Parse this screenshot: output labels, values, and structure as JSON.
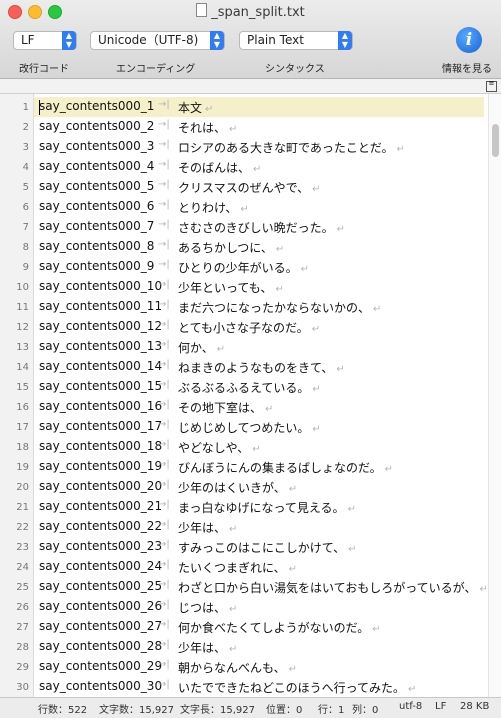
{
  "window": {
    "title": "_span_split.txt"
  },
  "toolbar": {
    "line_ending": {
      "value": "LF",
      "label": "改行コード"
    },
    "encoding": {
      "value": "Unicode（UTF-8)",
      "label": "エンコーディング"
    },
    "syntax": {
      "value": "Plain Text",
      "label": "シンタックス"
    },
    "info": {
      "label": "情報を見る"
    }
  },
  "editor": {
    "current_line": 1,
    "lines": [
      {
        "n": "1",
        "key": "say_contents000_1",
        "val": "本文"
      },
      {
        "n": "2",
        "key": "say_contents000_2",
        "val": "それは、"
      },
      {
        "n": "3",
        "key": "say_contents000_3",
        "val": "ロシアのある大きな町であったことだ。"
      },
      {
        "n": "4",
        "key": "say_contents000_4",
        "val": "そのばんは、"
      },
      {
        "n": "5",
        "key": "say_contents000_5",
        "val": "クリスマスのぜんやで、"
      },
      {
        "n": "6",
        "key": "say_contents000_6",
        "val": "とりわけ、"
      },
      {
        "n": "7",
        "key": "say_contents000_7",
        "val": "さむさのきびしい晩だった。"
      },
      {
        "n": "8",
        "key": "say_contents000_8",
        "val": "あるちかしつに、"
      },
      {
        "n": "9",
        "key": "say_contents000_9",
        "val": "ひとりの少年がいる。"
      },
      {
        "n": "10",
        "key": "say_contents000_10",
        "val": "少年といっても、"
      },
      {
        "n": "11",
        "key": "say_contents000_11",
        "val": "まだ六つになったかならないかの、"
      },
      {
        "n": "12",
        "key": "say_contents000_12",
        "val": "とても小さな子なのだ。"
      },
      {
        "n": "13",
        "key": "say_contents000_13",
        "val": "何か、"
      },
      {
        "n": "14",
        "key": "say_contents000_14",
        "val": "ねまきのようなものをきて、"
      },
      {
        "n": "15",
        "key": "say_contents000_15",
        "val": "ぶるぶるふるえている。"
      },
      {
        "n": "16",
        "key": "say_contents000_16",
        "val": "その地下室は、"
      },
      {
        "n": "17",
        "key": "say_contents000_17",
        "val": "じめじめしてつめたい。"
      },
      {
        "n": "18",
        "key": "say_contents000_18",
        "val": "やどなしや、"
      },
      {
        "n": "19",
        "key": "say_contents000_19",
        "val": "びんぼうにんの集まるばしょなのだ。"
      },
      {
        "n": "20",
        "key": "say_contents000_20",
        "val": "少年のはくいきが、"
      },
      {
        "n": "21",
        "key": "say_contents000_21",
        "val": "まっ白なゆげになって見える。"
      },
      {
        "n": "22",
        "key": "say_contents000_22",
        "val": "少年は、"
      },
      {
        "n": "23",
        "key": "say_contents000_23",
        "val": "すみっこのはこにこしかけて、"
      },
      {
        "n": "24",
        "key": "say_contents000_24",
        "val": "たいくつまぎれに、"
      },
      {
        "n": "25",
        "key": "say_contents000_25",
        "val": "わざと口から白い湯気をはいておもしろがっているが、"
      },
      {
        "n": "26",
        "key": "say_contents000_26",
        "val": "じつは、"
      },
      {
        "n": "27",
        "key": "say_contents000_27",
        "val": "何か食べたくてしようがないのだ。"
      },
      {
        "n": "28",
        "key": "say_contents000_28",
        "val": "少年は、"
      },
      {
        "n": "29",
        "key": "say_contents000_29",
        "val": "朝からなんべんも、"
      },
      {
        "n": "30",
        "key": "say_contents000_30",
        "val": "いたでできたねどこのほうへ行ってみた。"
      }
    ]
  },
  "status": {
    "lines": "行数：522",
    "chars": "文字数：15,927",
    "length": "文字長：15,927",
    "position": "位置：0",
    "row": "行：1",
    "col": "列：0",
    "encoding": "utf-8",
    "line_ending": "LF",
    "size": "28 KB"
  }
}
